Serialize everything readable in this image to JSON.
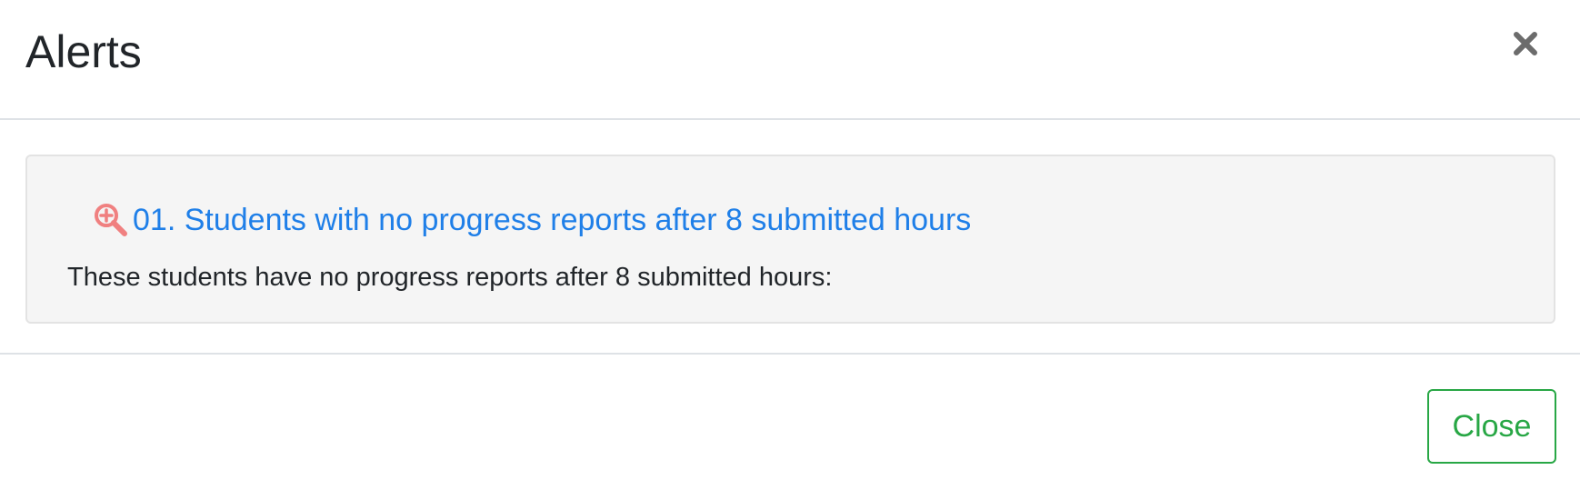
{
  "modal": {
    "title": "Alerts",
    "close_icon": "close-icon"
  },
  "alert": {
    "icon": "zoom-in-icon",
    "link_text": "01. Students with no progress reports after 8 submitted hours",
    "description": "These students have no progress reports after 8 submitted hours:"
  },
  "footer": {
    "close_label": "Close"
  },
  "colors": {
    "link": "#1f7fe8",
    "icon": "#f08080",
    "close_button": "#28a745",
    "well_background": "#f5f5f5"
  }
}
